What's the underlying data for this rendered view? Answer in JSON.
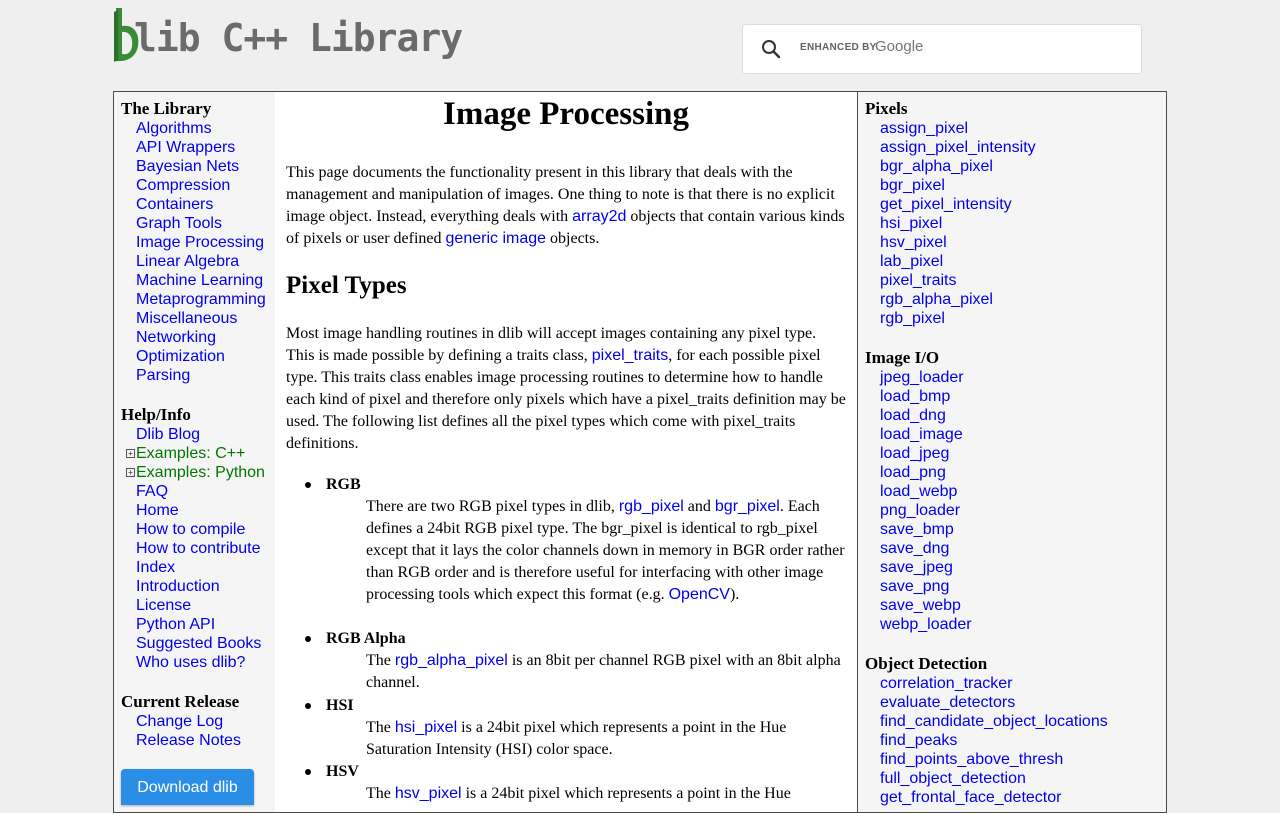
{
  "header": {
    "logo_text": "lib C++ Library",
    "search": {
      "enhanced_by": "ENHANCED BY",
      "google": "Google"
    }
  },
  "left_nav": {
    "library_title": "The Library",
    "library_items": [
      "Algorithms",
      "API Wrappers",
      "Bayesian Nets",
      "Compression",
      "Containers",
      "Graph Tools",
      "Image Processing",
      "Linear Algebra",
      "Machine Learning",
      "Metaprogramming",
      "Miscellaneous",
      "Networking",
      "Optimization",
      "Parsing"
    ],
    "help_title": "Help/Info",
    "help_items": [
      {
        "label": "Dlib Blog",
        "expandable": false
      },
      {
        "label": "Examples: C++",
        "expandable": true
      },
      {
        "label": "Examples: Python",
        "expandable": true
      },
      {
        "label": "FAQ",
        "expandable": false
      },
      {
        "label": "Home",
        "expandable": false
      },
      {
        "label": "How to compile",
        "expandable": false
      },
      {
        "label": "How to contribute",
        "expandable": false
      },
      {
        "label": "Index",
        "expandable": false
      },
      {
        "label": "Introduction",
        "expandable": false
      },
      {
        "label": "License",
        "expandable": false
      },
      {
        "label": "Python API",
        "expandable": false
      },
      {
        "label": "Suggested Books",
        "expandable": false
      },
      {
        "label": "Who uses dlib?",
        "expandable": false
      }
    ],
    "release_title": "Current Release",
    "release_items": [
      "Change Log",
      "Release Notes"
    ],
    "download_label": "Download dlib"
  },
  "main": {
    "title": "Image Processing",
    "intro": [
      {
        "t": "This page documents the functionality present in this library that deals with the management and manipulation of images. One thing to note is that there is no explicit image object. Instead, everything deals with "
      },
      {
        "link": "array2d"
      },
      {
        "t": " objects that contain various kinds of pixels or user defined "
      },
      {
        "link": "generic image"
      },
      {
        "t": " objects."
      }
    ],
    "pixel_types_heading": "Pixel Types",
    "pixel_types_intro": [
      {
        "t": "Most image handling routines in dlib will accept images containing any pixel type. This is made possible by defining a traits class, "
      },
      {
        "link": "pixel_traits"
      },
      {
        "t": ", for each possible pixel type. This traits class enables image processing routines to determine how to handle each kind of pixel and therefore only pixels which have a pixel_traits definition may be used. The following list defines all the pixel types which come with pixel_traits definitions."
      }
    ],
    "pixel_types": [
      {
        "name": "RGB",
        "desc": [
          {
            "t": "There are two RGB pixel types in dlib, "
          },
          {
            "link": "rgb_pixel"
          },
          {
            "t": " and "
          },
          {
            "link": "bgr_pixel"
          },
          {
            "t": ". Each defines a 24bit RGB pixel type. The bgr_pixel is identical to rgb_pixel except that it lays the color channels down in memory in BGR order rather than RGB order and is therefore useful for interfacing with other image processing tools which expect this format (e.g. "
          },
          {
            "link": "OpenCV"
          },
          {
            "t": ")."
          }
        ]
      },
      {
        "name": "RGB Alpha",
        "desc": [
          {
            "t": "The "
          },
          {
            "link": "rgb_alpha_pixel"
          },
          {
            "t": " is an 8bit per channel RGB pixel with an 8bit alpha channel."
          }
        ]
      },
      {
        "name": "HSI",
        "desc": [
          {
            "t": "The "
          },
          {
            "link": "hsi_pixel"
          },
          {
            "t": " is a 24bit pixel which represents a point in the Hue Saturation Intensity (HSI) color space."
          }
        ]
      },
      {
        "name": "HSV",
        "desc": [
          {
            "t": "The "
          },
          {
            "link": "hsv_pixel"
          },
          {
            "t": " is a 24bit pixel which represents a point in the Hue"
          }
        ]
      }
    ]
  },
  "right_nav": {
    "pixels_title": "Pixels",
    "pixels_items": [
      "assign_pixel",
      "assign_pixel_intensity",
      "bgr_alpha_pixel",
      "bgr_pixel",
      "get_pixel_intensity",
      "hsi_pixel",
      "hsv_pixel",
      "lab_pixel",
      "pixel_traits",
      "rgb_alpha_pixel",
      "rgb_pixel"
    ],
    "io_title": "Image I/O",
    "io_items": [
      "jpeg_loader",
      "load_bmp",
      "load_dng",
      "load_image",
      "load_jpeg",
      "load_png",
      "load_webp",
      "png_loader",
      "save_bmp",
      "save_dng",
      "save_jpeg",
      "save_png",
      "save_webp",
      "webp_loader"
    ],
    "od_title": "Object Detection",
    "od_items": [
      "correlation_tracker",
      "evaluate_detectors",
      "find_candidate_object_locations",
      "find_peaks",
      "find_points_above_thresh",
      "full_object_detection",
      "get_frontal_face_detector"
    ]
  },
  "colors": {
    "link": "#0000ee",
    "example_link": "#007700",
    "download_button": "#2b8ee6",
    "sidebar_bg": "#f5f5f5"
  }
}
